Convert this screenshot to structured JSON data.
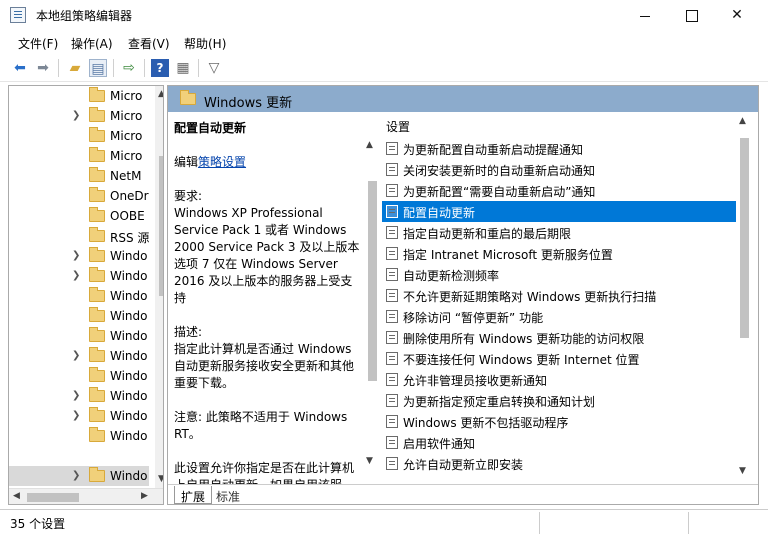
{
  "window": {
    "title": "本地组策略编辑器"
  },
  "menu": [
    "文件(F)",
    "操作(A)",
    "查看(V)",
    "帮助(H)"
  ],
  "toolbar_icons": [
    "back-icon",
    "forward-icon",
    "up-folder-icon",
    "show-hide-tree-icon",
    "export-list-icon",
    "help-icon",
    "properties-icon",
    "filter-icon"
  ],
  "tree": {
    "items": [
      {
        "label": "Micro",
        "expandable": false
      },
      {
        "label": "Micro",
        "expandable": true
      },
      {
        "label": "Micro",
        "expandable": false
      },
      {
        "label": "Micro",
        "expandable": false
      },
      {
        "label": "NetM",
        "expandable": false
      },
      {
        "label": "OneDr",
        "expandable": false
      },
      {
        "label": "OOBE",
        "expandable": false
      },
      {
        "label": "RSS 源",
        "expandable": false
      },
      {
        "label": "Windo",
        "expandable": true
      },
      {
        "label": "Windo",
        "expandable": true
      },
      {
        "label": "Windo",
        "expandable": false
      },
      {
        "label": "Windo",
        "expandable": false
      },
      {
        "label": "Windo",
        "expandable": false
      },
      {
        "label": "Windo",
        "expandable": true
      },
      {
        "label": "Windo",
        "expandable": false
      },
      {
        "label": "Windo",
        "expandable": true
      },
      {
        "label": "Windo",
        "expandable": true
      },
      {
        "label": "Windo",
        "expandable": false
      },
      {
        "label": "Windo",
        "expandable": true,
        "selected": true
      }
    ]
  },
  "pane": {
    "header": "Windows 更新",
    "description": {
      "title": "配置自动更新",
      "edit_prefix": "编辑",
      "edit_link": "策略设置",
      "requirements": "要求:\nWindows XP Professional Service Pack 1 或者 Windows 2000 Service Pack 3 及以上版本 选项 7 仅在 Windows Server 2016 及以上版本的服务器上受支持",
      "desc": "描述:\n指定此计算机是否通过 Windows 自动更新服务接收安全更新和其他重要下载。",
      "note": "注意: 此策略不适用于 Windows RT。",
      "tail": "此设置允许你指定是否在此计算机上启用自动更新。如果启用该服"
    },
    "list_header": "设置",
    "settings": [
      "为更新配置自动重新启动提醒通知",
      "关闭安装更新时的自动重新启动通知",
      "为更新配置“需要自动重新启动”通知",
      "配置自动更新",
      "指定自动更新和重启的最后期限",
      "指定 Intranet Microsoft 更新服务位置",
      "自动更新检测频率",
      "不允许更新延期策略对 Windows 更新执行扫描",
      "移除访问 “暂停更新” 功能",
      "删除使用所有 Windows 更新功能的访问权限",
      "不要连接任何 Windows 更新 Internet 位置",
      "允许非管理员接收更新通知",
      "为更新指定预定重启转换和通知计划",
      "Windows 更新不包括驱动程序",
      "启用软件通知",
      "允许自动更新立即安装"
    ],
    "selected_index": 3,
    "tabs": [
      "扩展",
      "标准"
    ]
  },
  "status": "35 个设置"
}
